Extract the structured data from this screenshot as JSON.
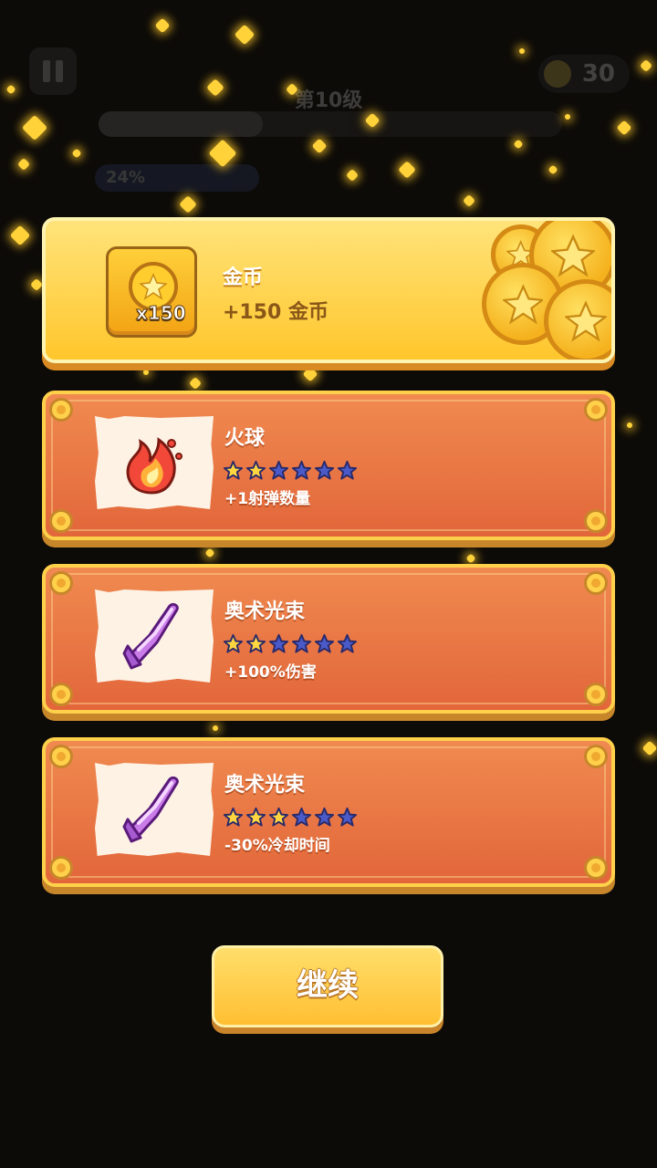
{
  "hud": {
    "level_label": "第10级",
    "coin_count": "30",
    "progress_pct": "24%"
  },
  "gold_reward": {
    "title": "金币",
    "amount_text": "+150 金币",
    "icon_qty": "x150",
    "icon": "gold-coin-icon"
  },
  "upgrades": [
    {
      "title": "火球",
      "desc": "+1射弹数量",
      "icon": "fireball-icon",
      "stars_filled": 2,
      "stars_total": 6
    },
    {
      "title": "奥术光束",
      "desc": "+100%伤害",
      "icon": "arcane-beam-crystal-icon",
      "stars_filled": 2,
      "stars_total": 6
    },
    {
      "title": "奥术光束",
      "desc": "-30%冷却时间",
      "icon": "arcane-beam-crystal-icon",
      "stars_filled": 3,
      "stars_total": 6
    }
  ],
  "continue_label": "继续",
  "colors": {
    "gold_card": "#ffc62c",
    "upgrade_card": "#e8703f",
    "star_filled": "#ffd640",
    "star_empty": "#4a5ac8"
  }
}
